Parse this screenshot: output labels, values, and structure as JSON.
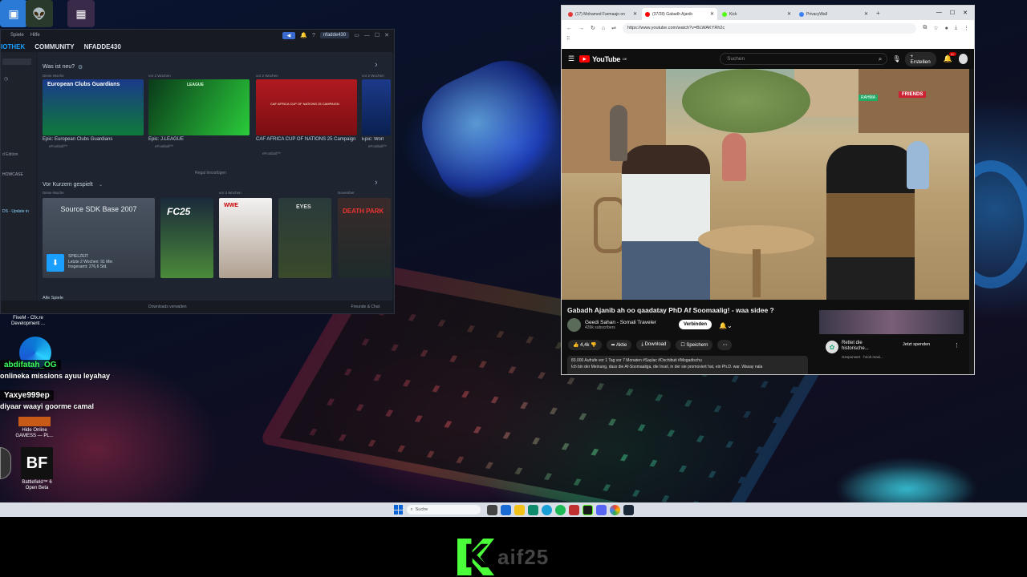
{
  "steam": {
    "menu": {
      "items": [
        "Spiele",
        "Hilfe"
      ]
    },
    "titlebar": {
      "user": "nfadde430",
      "button": "◀"
    },
    "nav": [
      "IOTHEK",
      "COMMUNITY",
      "NFADDE430"
    ],
    "sidebar": {
      "edition": "d Edition",
      "showcase": "HOWCASE",
      "update": "DS - Update in"
    },
    "whats_new": {
      "heading": "Was ist neu?",
      "groups": [
        "Diese Woche",
        "vor 2 Wochen",
        "vor 2 Wochen",
        "vor 2 Wochen"
      ],
      "cards": [
        {
          "banner": "European Clubs Guardians",
          "caption": "Epic: European Clubs Guardians",
          "source": "eFootball™"
        },
        {
          "banner": "LEAGUE",
          "caption": "Epic: J.LEAGUE",
          "source": "eFootball™"
        },
        {
          "banner": "CAF AFRICA CUP OF NATIONS 25 CAMPAIGN",
          "caption": "CAF AFRICA CUP OF NATIONS 25 Campaign",
          "source": "eFootball™"
        },
        {
          "banner": "",
          "caption": "Epic: Worl",
          "source": "eFootball™"
        }
      ]
    },
    "shelf_add": "Regal hinzufügen",
    "recent": {
      "heading": "Vor Kurzem gespielt",
      "groups": [
        "Diese Woche",
        "vor 3 Wochen",
        "November"
      ],
      "sdk_title": "Source SDK Base 2007",
      "playtime_label": "SPIELZEIT",
      "playtime_recent": "Letzte 2 Wochen: 91 Min",
      "playtime_total": "Insgesamt: 276,6 Std.",
      "games": [
        "FC25",
        "WWE",
        "EYES",
        "DEATH PARK"
      ]
    },
    "all_games": "Alle Spiele",
    "status": {
      "downloads": "Downloads verwalten",
      "friends": "Freunde & Chat"
    }
  },
  "browser": {
    "tabs": [
      {
        "label": "(17) Mohamed Farmaajo on",
        "fav_color": "#e53935"
      },
      {
        "label": "(37/28) Gabadh Ajanib",
        "fav_color": "#ff0000"
      },
      {
        "label": "Kick",
        "fav_color": "#53fc18"
      },
      {
        "label": "PrivacyWall",
        "fav_color": "#3b82f6"
      }
    ],
    "url": "https://www.youtube.com/watch?v=BLWAKYRh2c"
  },
  "youtube": {
    "logo": "YouTube",
    "logo_region": "DE",
    "search_placeholder": "Suchen",
    "create": "Erstellen",
    "notifications": "9+",
    "video_title": "Gabadh Ajanib ah oo qaadatay PhD Af Soomaalig! - waa sidee ?",
    "channel": "Geedi Sahan - Somali Traveler",
    "subscribers": "439k subscribers",
    "subscribe": "Verbinden",
    "likes": "4,4k",
    "share": "Aktie",
    "download": "Download",
    "save": "Speichern",
    "views_line": "83.000 Aufrufe vor 1 Tag  vor 7 Monaten  #Saylac #Dschibuti #Mogadischu",
    "desc_line": "Ich bin der Meinung, dass die Af-Soomaaliga, die Insel, in der sie promoviert hat, ein Ph.D. war. Waxay nala",
    "ad": {
      "title": "Rettet die historische...",
      "sponsored": "Gesponsert · hrioh.masi...",
      "button": "Jetzt spenden"
    },
    "video_signs": [
      "RAHMA",
      "FRIENDS"
    ]
  },
  "chat": [
    {
      "name": "abdifatah_OG",
      "message": "onlineka missions ayuu leyahay",
      "name_color": "#3bff5c"
    },
    {
      "name": "Yaxye999ep",
      "message": "diyaar waayi goorme camal",
      "name_color": "#ffffff"
    }
  ],
  "desktop_icons": [
    "FiveM - Cfx.re Development ...",
    "Hide Online GAMESS — PL...",
    "Battlefield™ 6 Open Beta"
  ],
  "taskbar": {
    "search": "Suche"
  },
  "brand": {
    "text": "aif25"
  }
}
